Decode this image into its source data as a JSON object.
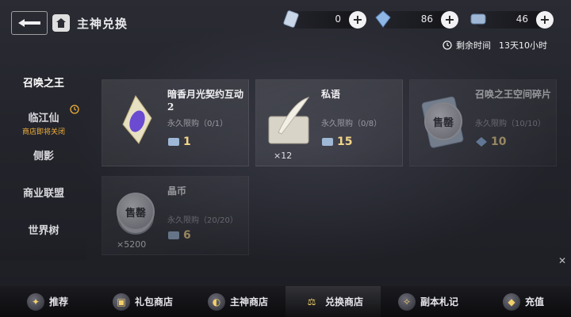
{
  "header": {
    "title": "主神兑换"
  },
  "currencies": [
    {
      "icon": "crystal-icon",
      "value": "0"
    },
    {
      "icon": "blue-gem-icon",
      "value": "86"
    },
    {
      "icon": "token-icon",
      "value": "46"
    }
  ],
  "timer": {
    "label": "剩余时间",
    "value": "13天10小时"
  },
  "sidebar": {
    "items": [
      {
        "label": "召唤之王",
        "sub": ""
      },
      {
        "label": "临江仙",
        "sub": "商店即将关闭"
      },
      {
        "label": "侧影",
        "sub": ""
      },
      {
        "label": "商业联盟",
        "sub": ""
      },
      {
        "label": "世界树",
        "sub": ""
      }
    ]
  },
  "cards": [
    {
      "name": "暗香月光契约互动2",
      "limit": "永久限购（0/1）",
      "price": "1",
      "qty": "",
      "sold_out": false,
      "icon": "purple-crystal-icon"
    },
    {
      "name": "私语",
      "limit": "永久限购（0/8）",
      "price": "15",
      "qty": "×12",
      "sold_out": false,
      "icon": "feather-letter-icon"
    },
    {
      "name": "召唤之王空间碎片",
      "limit": "永久限购（10/10）",
      "price": "10",
      "qty": "",
      "sold_out": true,
      "stamp": "售罄",
      "icon": "card-fragment-icon"
    },
    {
      "name": "晶币",
      "limit": "永久限购（20/20）",
      "price": "6",
      "qty": "×5200",
      "sold_out": true,
      "stamp": "售罄",
      "icon": "coin-icon"
    }
  ],
  "bottom_nav": [
    {
      "label": "推荐",
      "icon": "recommend-icon"
    },
    {
      "label": "礼包商店",
      "icon": "gift-icon"
    },
    {
      "label": "主神商店",
      "icon": "god-shop-icon"
    },
    {
      "label": "兑换商店",
      "icon": "exchange-icon",
      "active": true
    },
    {
      "label": "副本札记",
      "icon": "notes-icon"
    },
    {
      "label": "充值",
      "icon": "recharge-icon"
    }
  ],
  "colors": {
    "price_gold": "#f3d58a",
    "warning_orange": "#f2b03a"
  }
}
